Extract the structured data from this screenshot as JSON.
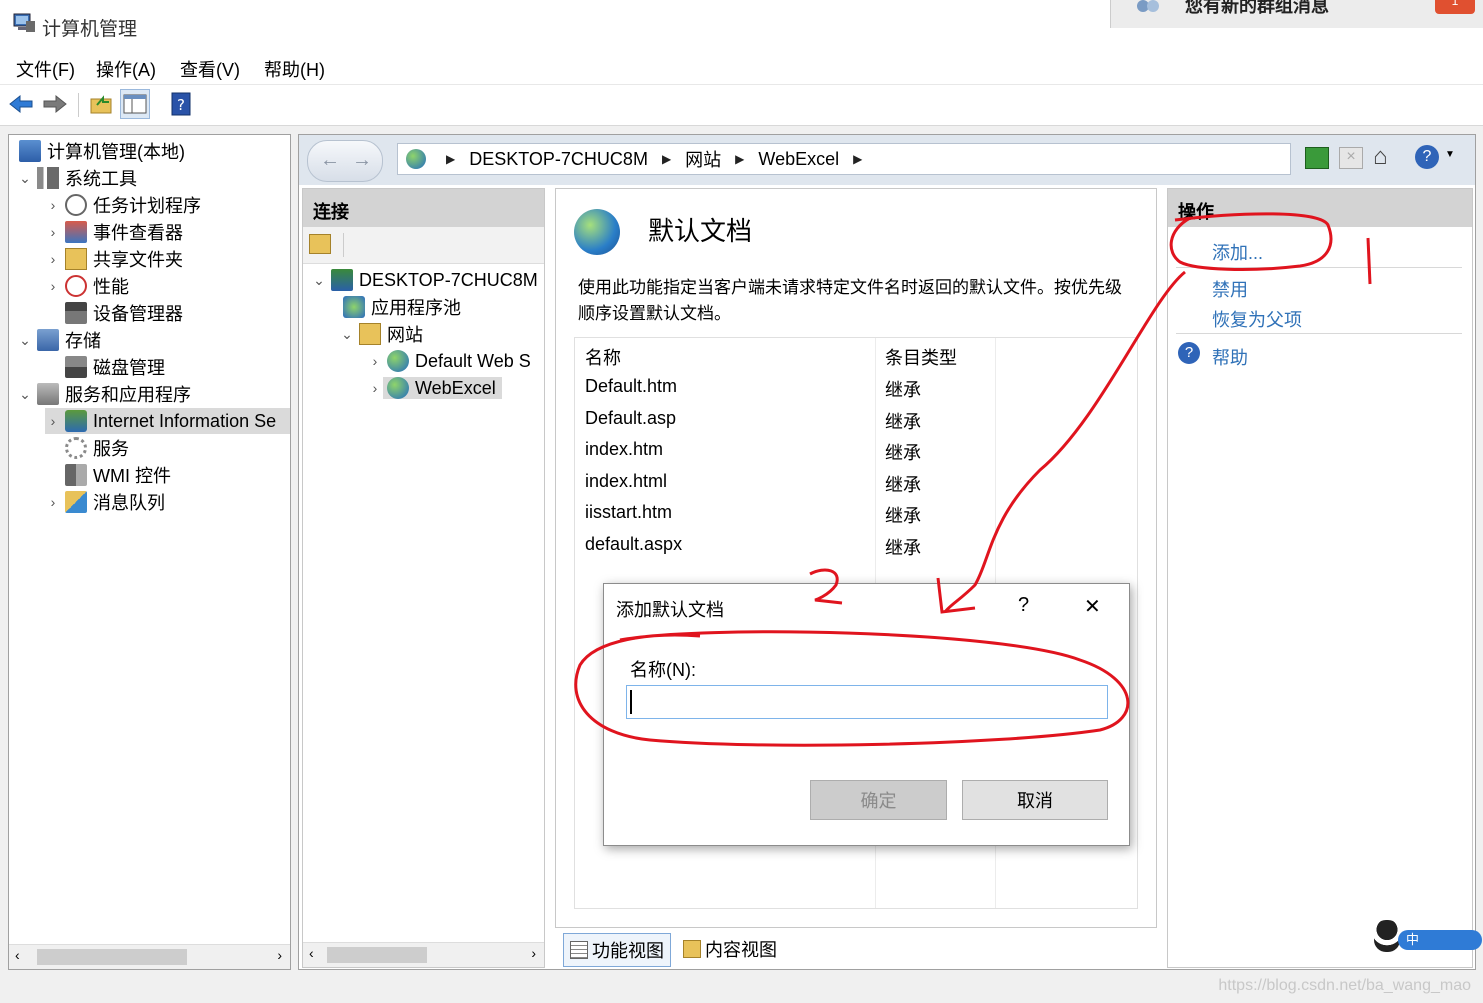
{
  "window": {
    "title": "计算机管理"
  },
  "notification": {
    "text": "您有新的群组消息",
    "badge": "1"
  },
  "menu": [
    "文件(F)",
    "操作(A)",
    "查看(V)",
    "帮助(H)"
  ],
  "tree": {
    "root": "计算机管理(本地)",
    "items": [
      {
        "label": "系统工具",
        "icon": "tools-icon"
      },
      {
        "label": "任务计划程序",
        "icon": "clock-icon"
      },
      {
        "label": "事件查看器",
        "icon": "event-viewer-icon"
      },
      {
        "label": "共享文件夹",
        "icon": "shared-folder-icon"
      },
      {
        "label": "性能",
        "icon": "performance-icon"
      },
      {
        "label": "设备管理器",
        "icon": "device-manager-icon"
      },
      {
        "label": "存储",
        "icon": "storage-icon"
      },
      {
        "label": "磁盘管理",
        "icon": "disk-icon"
      },
      {
        "label": "服务和应用程序",
        "icon": "services-apps-icon"
      },
      {
        "label": "Internet Information Se",
        "icon": "iis-icon"
      },
      {
        "label": "服务",
        "icon": "gear-icon"
      },
      {
        "label": "WMI 控件",
        "icon": "wmi-icon"
      },
      {
        "label": "消息队列",
        "icon": "message-queue-icon"
      }
    ]
  },
  "breadcrumb": [
    "DESKTOP-7CHUC8M",
    "网站",
    "WebExcel"
  ],
  "connections": {
    "header": "连接",
    "nodes": [
      "DESKTOP-7CHUC8M",
      "应用程序池",
      "网站",
      "Default Web S",
      "WebExcel"
    ]
  },
  "feature": {
    "title": "默认文档",
    "description": "使用此功能指定当客户端未请求特定文件名时返回的默认文件。按优先级顺序设置默认文档。",
    "columns": [
      "名称",
      "条目类型"
    ],
    "rows": [
      {
        "name": "Default.htm",
        "type": "继承"
      },
      {
        "name": "Default.asp",
        "type": "继承"
      },
      {
        "name": "index.htm",
        "type": "继承"
      },
      {
        "name": "index.html",
        "type": "继承"
      },
      {
        "name": "iisstart.htm",
        "type": "继承"
      },
      {
        "name": "default.aspx",
        "type": "继承"
      }
    ]
  },
  "tabs": {
    "features_view": "功能视图",
    "content_view": "内容视图"
  },
  "actions": {
    "header": "操作",
    "add": "添加...",
    "disable": "禁用",
    "revert": "恢复为父项",
    "help": "帮助"
  },
  "dialog": {
    "title": "添加默认文档",
    "help_glyph": "?",
    "close_glyph": "✕",
    "name_label": "名称(N):",
    "name_value": "",
    "ok": "确定",
    "cancel": "取消"
  },
  "annotations": {
    "step1": "1",
    "step2": "2"
  },
  "watermark": "https://blog.csdn.net/ba_wang_mao",
  "ime": {
    "lang": "中"
  },
  "colors": {
    "link": "#3072b8",
    "annotation": "#e0141e",
    "panel_header": "#d3d3d3"
  }
}
